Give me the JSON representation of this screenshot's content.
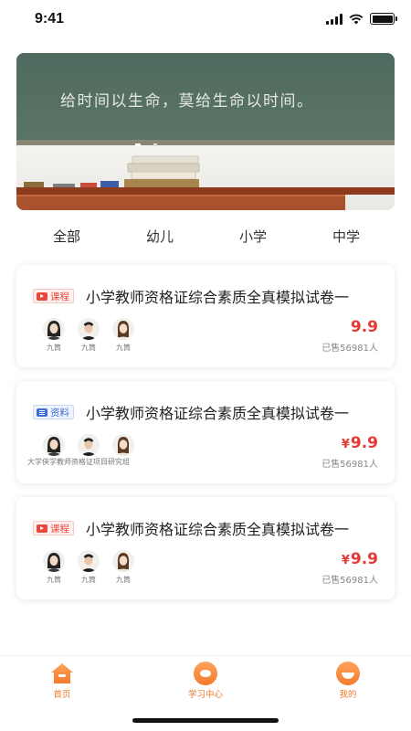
{
  "status_bar": {
    "time": "9:41"
  },
  "banner": {
    "chalk_text": "给时间以生命，莫给生命以时间。"
  },
  "tabs": [
    {
      "label": "全部",
      "active": true
    },
    {
      "label": "幼儿",
      "active": false
    },
    {
      "label": "小学",
      "active": false
    },
    {
      "label": "中学",
      "active": false
    }
  ],
  "cards": [
    {
      "badge": "课程",
      "badge_type": "course",
      "title": "小学教师资格证综合素质全真模拟试卷一",
      "teachers": [
        "九筒",
        "九筒",
        "九筒"
      ],
      "org": "",
      "currency": "",
      "price": "9.9",
      "sold": "已售56981人"
    },
    {
      "badge": "资料",
      "badge_type": "material",
      "title": "小学教师资格证综合素质全真模拟试卷一",
      "teachers": [
        "",
        "",
        ""
      ],
      "org": "大学侠学教师资格证项目研究组",
      "currency": "¥",
      "price": "9.9",
      "sold": "已售56981人"
    },
    {
      "badge": "课程",
      "badge_type": "course",
      "title": "小学教师资格证综合素质全真模拟试卷一",
      "teachers": [
        "九筒",
        "九筒",
        "九筒"
      ],
      "org": "",
      "currency": "¥",
      "price": "9.9",
      "sold": "已售56981人"
    }
  ],
  "bottom_nav": [
    {
      "label": "首页",
      "icon": "home-icon"
    },
    {
      "label": "学习中心",
      "icon": "study-center-icon"
    },
    {
      "label": "我的",
      "icon": "profile-icon"
    }
  ],
  "colors": {
    "accent": "#f07a2d",
    "price": "#e53935",
    "tab_underline": "#f4a26a"
  }
}
